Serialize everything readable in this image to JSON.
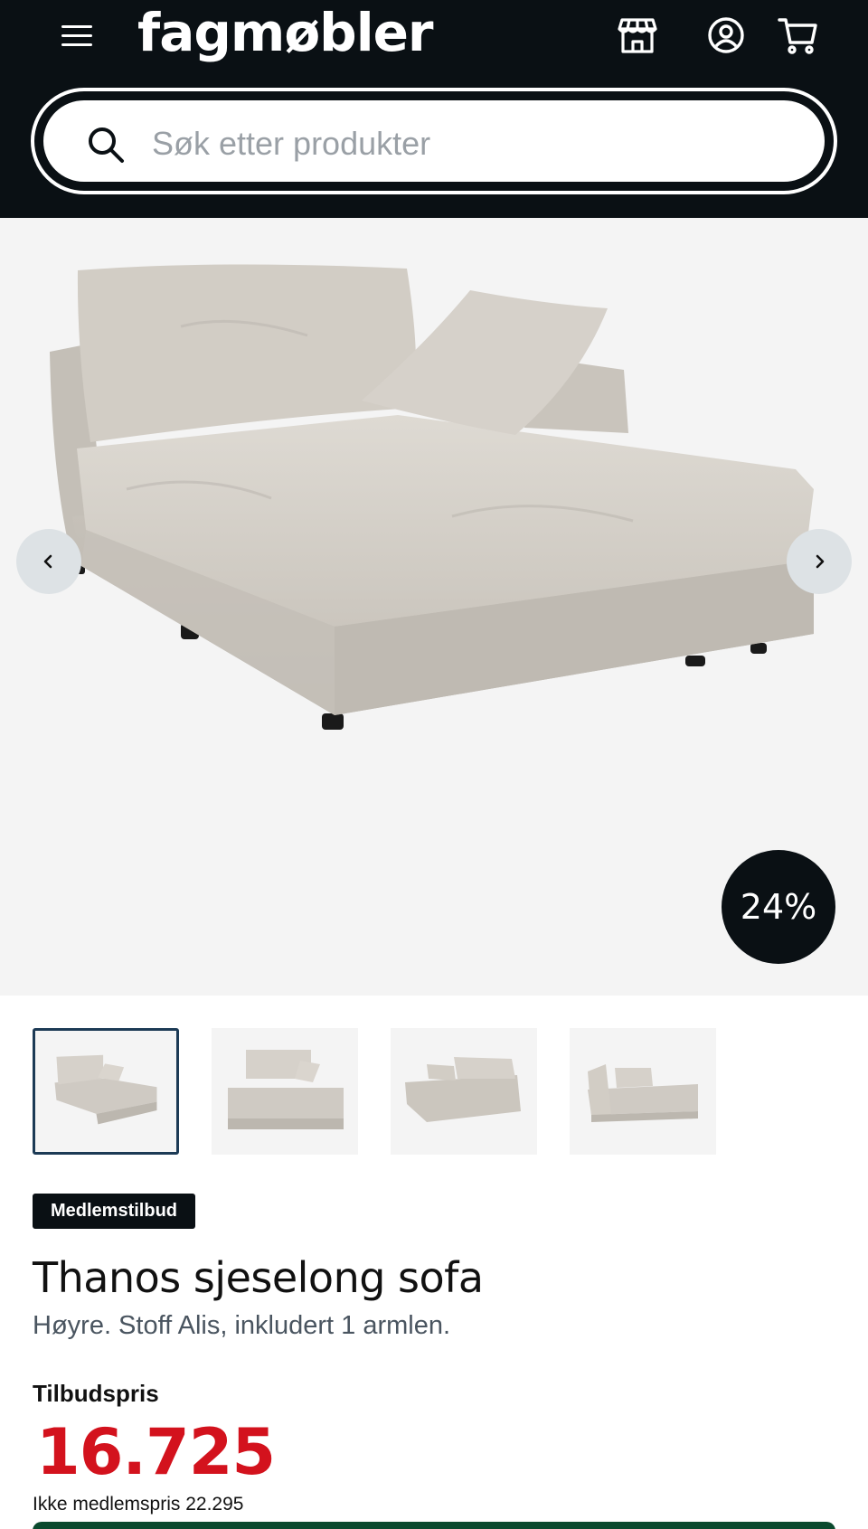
{
  "header": {
    "logo": "fagmøbler",
    "icons": [
      "menu-icon",
      "store-icon",
      "account-icon",
      "cart-icon"
    ]
  },
  "search": {
    "placeholder": "Søk etter produkter",
    "value": ""
  },
  "gallery": {
    "discount_badge": "24%",
    "thumbnail_count": 4,
    "active_thumbnail": 1
  },
  "product": {
    "badge": "Medlemstilbud",
    "title": "Thanos sjeselong sofa",
    "subtitle": "Høyre. Stoff Alis, inkludert 1 armlen.",
    "price_label": "Tilbudspris",
    "price": "16.725",
    "regular_price": "Ikke medlemspris 22.295"
  },
  "colors": {
    "header_bg": "#0a1014",
    "price_red": "#d3121d",
    "cta_green": "#0b4a2e",
    "sofa_fabric": "#cfcac3"
  }
}
